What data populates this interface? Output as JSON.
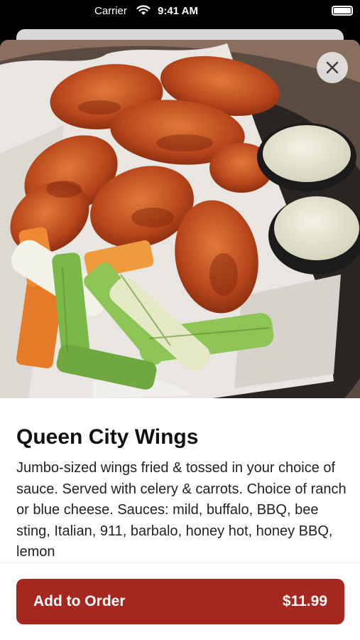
{
  "status_bar": {
    "carrier": "Carrier",
    "time": "9:41 AM"
  },
  "item": {
    "image_subject": "buffalo chicken wings with celery, carrots and ranch dip",
    "name": "Queen City Wings",
    "description": "Jumbo-sized wings fried & tossed in your choice of sauce. Served with celery & carrots. Choice of ranch or blue cheese. Sauces: mild, buffalo, BBQ, bee sting, Italian, 911, barbalo, honey hot, honey BBQ, lemon"
  },
  "order_button": {
    "label": "Add to Order",
    "price": "$11.99"
  },
  "colors": {
    "accent": "#a5271f",
    "background": "#ffffff"
  },
  "icons": [
    "wifi-icon",
    "battery-icon",
    "close-icon"
  ]
}
